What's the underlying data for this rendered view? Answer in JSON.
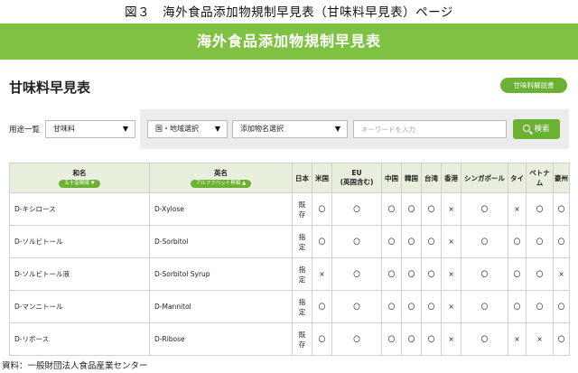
{
  "figure_caption": "図３　海外食品添加物規制早見表（甘味料早見表）ページ",
  "banner_title": "海外食品添加物規制早見表",
  "section_title": "甘味料早見表",
  "explain_button": "甘味料解説書",
  "filters": {
    "use_label": "用途一覧",
    "use_value": "甘味料",
    "region_value": "国・地域選択",
    "additive_value": "添加物名選択",
    "keyword_placeholder": "キーワードを入力",
    "search_label": "検索"
  },
  "table": {
    "headers": {
      "japanese_name": "和名",
      "japanese_sort": "五十音降順",
      "english_name": "英名",
      "english_sort": "アルファベット昇順"
    },
    "countries": [
      "日本",
      "米国",
      "EU\n(英国含む)",
      "中国",
      "韓国",
      "台湾",
      "香港",
      "シンガポール",
      "タイ",
      "ベトナム",
      "豪州"
    ],
    "rows": [
      {
        "ja": "D-キシロース",
        "en": "D-Xylose",
        "japan": "既存",
        "cells": [
          "〇",
          "〇",
          "〇",
          "〇",
          "〇",
          "×",
          "〇",
          "×",
          "〇",
          "〇"
        ]
      },
      {
        "ja": "D-ソルビトール",
        "en": "D-Sorbitol",
        "japan": "指定",
        "cells": [
          "〇",
          "〇",
          "〇",
          "〇",
          "〇",
          "×",
          "〇",
          "〇",
          "〇",
          "〇"
        ]
      },
      {
        "ja": "D-ソルビトール液",
        "en": "D-Sorbitol Syrup",
        "japan": "指定",
        "cells": [
          "×",
          "〇",
          "〇",
          "〇",
          "〇",
          "×",
          "〇",
          "〇",
          "〇",
          "×"
        ]
      },
      {
        "ja": "D-マンニトール",
        "en": "D-Mannitol",
        "japan": "指定",
        "cells": [
          "〇",
          "〇",
          "〇",
          "〇",
          "〇",
          "×",
          "〇",
          "〇",
          "〇",
          "〇"
        ]
      },
      {
        "ja": "D-リボース",
        "en": "D-Ribose",
        "japan": "既存",
        "cells": [
          "〇",
          "〇",
          "〇",
          "〇",
          "〇",
          "×",
          "〇",
          "×",
          "×",
          "〇"
        ]
      }
    ]
  },
  "source_note": "資料：一般財団法人食品産業センター",
  "colors": {
    "accent": "#7fc143",
    "button": "#6bb134",
    "header_bg": "#e8efdd"
  }
}
